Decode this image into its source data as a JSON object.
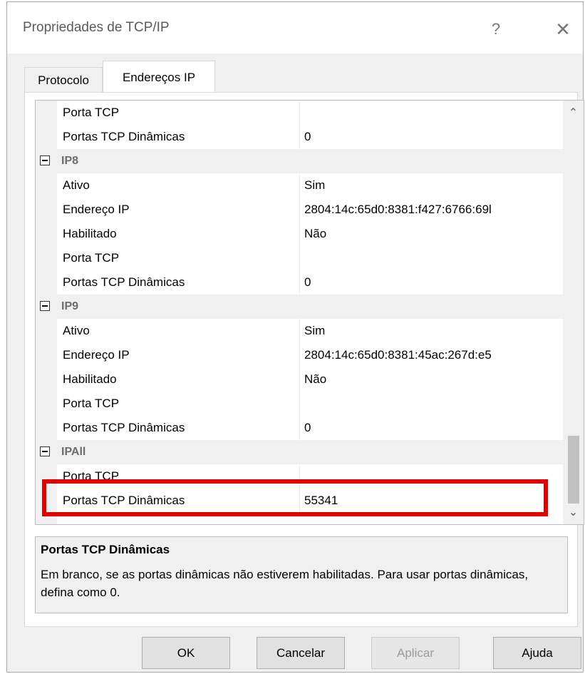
{
  "window": {
    "title": "Propriedades de TCP/IP",
    "help_glyph": "?",
    "close_glyph": "✕"
  },
  "tabs": [
    {
      "label": "Protocolo"
    },
    {
      "label": "Endereços IP"
    }
  ],
  "grid": {
    "rows": [
      {
        "type": "prop",
        "label": "Porta TCP",
        "value": ""
      },
      {
        "type": "prop",
        "label": "Portas TCP Dinâmicas",
        "value": "0"
      },
      {
        "type": "category",
        "label": "IP8"
      },
      {
        "type": "prop",
        "label": "Ativo",
        "value": "Sim"
      },
      {
        "type": "prop",
        "label": "Endereço IP",
        "value": "2804:14c:65d0:8381:f427:6766:69l"
      },
      {
        "type": "prop",
        "label": "Habilitado",
        "value": "Não"
      },
      {
        "type": "prop",
        "label": "Porta TCP",
        "value": ""
      },
      {
        "type": "prop",
        "label": "Portas TCP Dinâmicas",
        "value": "0"
      },
      {
        "type": "category",
        "label": "IP9"
      },
      {
        "type": "prop",
        "label": "Ativo",
        "value": "Sim"
      },
      {
        "type": "prop",
        "label": "Endereço IP",
        "value": "2804:14c:65d0:8381:45ac:267d:e5"
      },
      {
        "type": "prop",
        "label": "Habilitado",
        "value": "Não"
      },
      {
        "type": "prop",
        "label": "Porta TCP",
        "value": ""
      },
      {
        "type": "prop",
        "label": "Portas TCP Dinâmicas",
        "value": "0"
      },
      {
        "type": "category",
        "label": "IPAll"
      },
      {
        "type": "prop",
        "label": "Porta TCP",
        "value": ""
      },
      {
        "type": "prop",
        "label": "Portas TCP Dinâmicas",
        "value": "55341"
      }
    ],
    "scroll_up_glyph": "⌃",
    "scroll_down_glyph": "⌄"
  },
  "description": {
    "title": "Portas TCP Dinâmicas",
    "text": "Em branco, se as portas dinâmicas não estiverem habilitadas. Para usar portas dinâmicas, defina como 0."
  },
  "buttons": {
    "ok": "OK",
    "cancel": "Cancelar",
    "apply": "Aplicar",
    "help": "Ajuda"
  },
  "colors": {
    "highlight": "#e00000"
  }
}
